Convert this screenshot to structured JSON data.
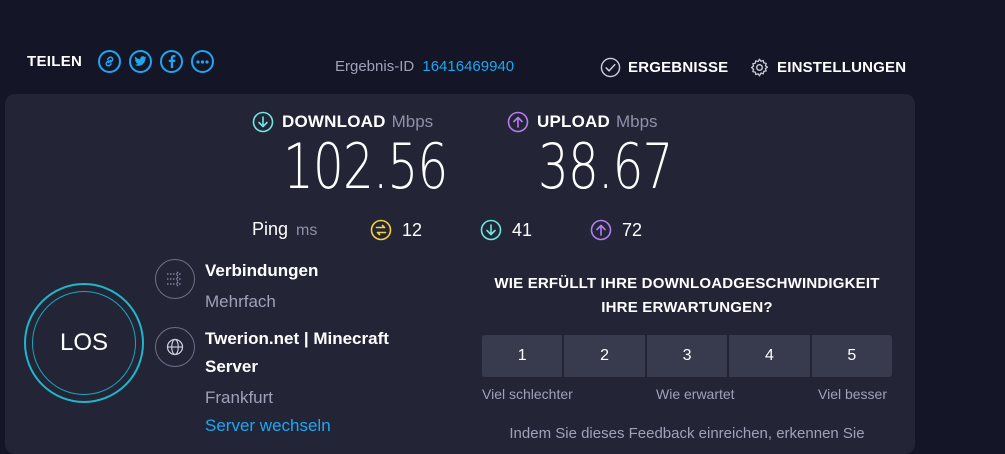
{
  "topbar": {
    "share_label": "TEILEN",
    "share_icons": [
      "link-icon",
      "twitter-icon",
      "facebook-icon",
      "more-icon"
    ],
    "result_label": "Ergebnis-ID",
    "result_id": "16416469940",
    "results_link": "ERGEBNISSE",
    "settings_link": "EINSTELLUNGEN"
  },
  "download": {
    "label": "DOWNLOAD",
    "unit": "Mbps",
    "value": "102.56",
    "color": "#6ee7e0"
  },
  "upload": {
    "label": "UPLOAD",
    "unit": "Mbps",
    "value": "38.67",
    "color": "#b57cf2"
  },
  "ping": {
    "label": "Ping",
    "unit": "ms",
    "idle": "12",
    "download": "41",
    "upload": "72",
    "idle_color": "#f3d33d"
  },
  "go_button": {
    "label": "LOS",
    "color": "#21b5c9"
  },
  "connections": {
    "title": "Verbindungen",
    "value": "Mehrfach"
  },
  "server": {
    "title": "Twerion.net | Minecraft Server",
    "location": "Frankfurt",
    "change_link": "Server wechseln"
  },
  "feedback": {
    "question": "WIE ERFÜLLT IHRE DOWNLOADGESCHWINDIGKEIT IHRE ERWARTUNGEN?",
    "ratings": [
      "1",
      "2",
      "3",
      "4",
      "5"
    ],
    "scale_low": "Viel schlechter",
    "scale_mid": "Wie erwartet",
    "scale_high": "Viel besser",
    "note": "Indem Sie dieses Feedback einreichen, erkennen Sie"
  },
  "colors": {
    "accent": "#1ea7f0",
    "panel": "#232537",
    "background": "#141526"
  }
}
